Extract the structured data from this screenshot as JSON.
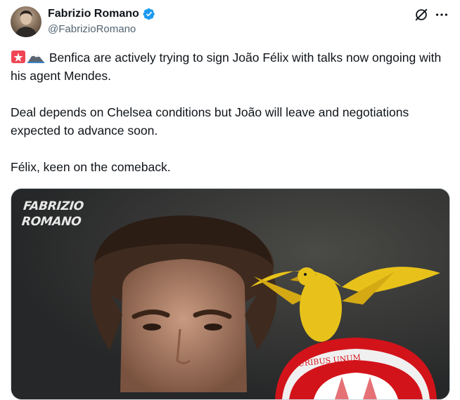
{
  "author": {
    "display_name": "Fabrizio Romano",
    "handle": "@FabrizioRomano",
    "verified_color": "#1d9bf0"
  },
  "icons": {
    "verified": "verified-badge-icon",
    "grok": "grok-icon",
    "more": "more-options-icon",
    "emoji_1": "rotating-light-icon",
    "emoji_2": "eagle-icon"
  },
  "tweet": {
    "line1": "Benfica are actively trying to sign João Félix with talks now ongoing with his agent Mendes.",
    "line2": "Deal depends on Chelsea conditions but João will leave and negotiations expected to advance soon.",
    "line3": "Félix, keen on the comeback."
  },
  "media": {
    "watermark_line1": "FABRIZIO",
    "watermark_line2": "ROMANO",
    "badge_motto": "URIBUS UNUM"
  },
  "colors": {
    "text": "#0f1419",
    "secondary": "#536471",
    "crest_red": "#d3131a",
    "eagle_yellow": "#e8c21a"
  }
}
